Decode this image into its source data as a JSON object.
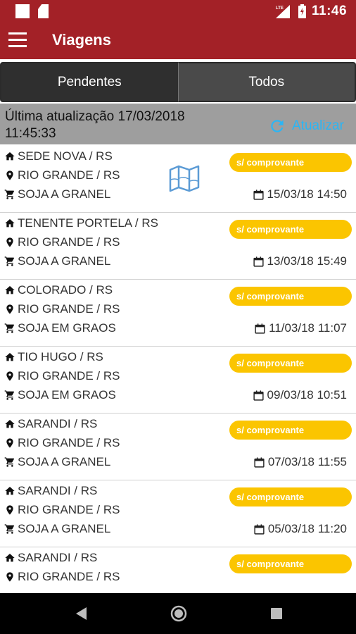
{
  "status_bar": {
    "time": "11:46",
    "icons": [
      "notification-square-icon",
      "sd-card-icon",
      "lte-signal-icon",
      "battery-icon"
    ]
  },
  "app_bar": {
    "title": "Viagens",
    "menu_icon": "hamburger-menu-icon"
  },
  "tabs": [
    {
      "label": "Pendentes",
      "active": true
    },
    {
      "label": "Todos",
      "active": false
    }
  ],
  "update_bar": {
    "last_update": "Última atualização 17/03/2018 11:45:33",
    "refresh_label": "Atualizar",
    "refresh_icon": "refresh-icon",
    "refresh_color": "#29b6f6"
  },
  "colors": {
    "primary": "#a32127",
    "badge": "#fbc500",
    "tab_active": "#2f2f2f",
    "tab_inactive": "#4a4a4a",
    "update_bar": "#9e9e9e"
  },
  "trips": [
    {
      "origin": "SEDE NOVA / RS",
      "destination": "RIO GRANDE / RS",
      "cargo": "SOJA A GRANEL",
      "badge": "s/ comprovante",
      "date": "15/03/18 14:50",
      "has_map": true
    },
    {
      "origin": "TENENTE PORTELA / RS",
      "destination": "RIO GRANDE / RS",
      "cargo": "SOJA A GRANEL",
      "badge": "s/ comprovante",
      "date": "13/03/18 15:49",
      "has_map": false
    },
    {
      "origin": "COLORADO / RS",
      "destination": "RIO GRANDE / RS",
      "cargo": "SOJA EM GRAOS",
      "badge": "s/ comprovante",
      "date": "11/03/18 11:07",
      "has_map": false
    },
    {
      "origin": "TIO HUGO / RS",
      "destination": "RIO GRANDE / RS",
      "cargo": "SOJA EM GRAOS",
      "badge": "s/ comprovante",
      "date": "09/03/18 10:51",
      "has_map": false
    },
    {
      "origin": "SARANDI / RS",
      "destination": "RIO GRANDE / RS",
      "cargo": "SOJA A GRANEL",
      "badge": "s/ comprovante",
      "date": "07/03/18 11:55",
      "has_map": false
    },
    {
      "origin": "SARANDI / RS",
      "destination": "RIO GRANDE / RS",
      "cargo": "SOJA A GRANEL",
      "badge": "s/ comprovante",
      "date": "05/03/18 11:20",
      "has_map": false
    },
    {
      "origin": "SARANDI / RS",
      "destination": "RIO GRANDE / RS",
      "cargo": "",
      "badge": "s/ comprovante",
      "date": "",
      "has_map": false
    }
  ],
  "nav_bar": {
    "icons": [
      "back-icon",
      "home-icon",
      "recents-icon"
    ]
  }
}
